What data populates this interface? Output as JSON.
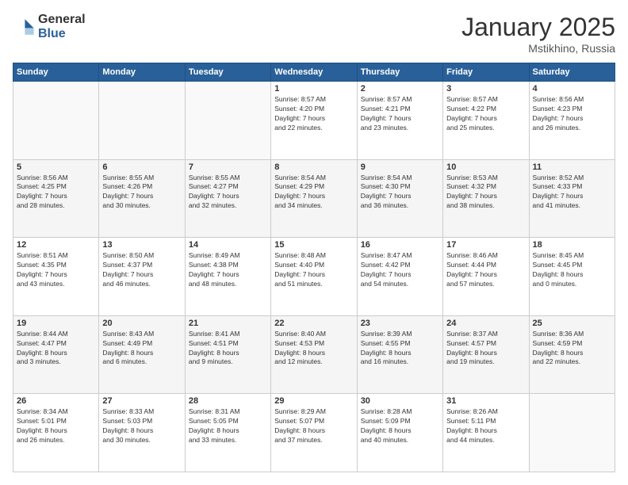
{
  "logo": {
    "general": "General",
    "blue": "Blue"
  },
  "title": "January 2025",
  "location": "Mstikhino, Russia",
  "days_header": [
    "Sunday",
    "Monday",
    "Tuesday",
    "Wednesday",
    "Thursday",
    "Friday",
    "Saturday"
  ],
  "weeks": [
    [
      {
        "day": "",
        "info": ""
      },
      {
        "day": "",
        "info": ""
      },
      {
        "day": "",
        "info": ""
      },
      {
        "day": "1",
        "info": "Sunrise: 8:57 AM\nSunset: 4:20 PM\nDaylight: 7 hours\nand 22 minutes."
      },
      {
        "day": "2",
        "info": "Sunrise: 8:57 AM\nSunset: 4:21 PM\nDaylight: 7 hours\nand 23 minutes."
      },
      {
        "day": "3",
        "info": "Sunrise: 8:57 AM\nSunset: 4:22 PM\nDaylight: 7 hours\nand 25 minutes."
      },
      {
        "day": "4",
        "info": "Sunrise: 8:56 AM\nSunset: 4:23 PM\nDaylight: 7 hours\nand 26 minutes."
      }
    ],
    [
      {
        "day": "5",
        "info": "Sunrise: 8:56 AM\nSunset: 4:25 PM\nDaylight: 7 hours\nand 28 minutes."
      },
      {
        "day": "6",
        "info": "Sunrise: 8:55 AM\nSunset: 4:26 PM\nDaylight: 7 hours\nand 30 minutes."
      },
      {
        "day": "7",
        "info": "Sunrise: 8:55 AM\nSunset: 4:27 PM\nDaylight: 7 hours\nand 32 minutes."
      },
      {
        "day": "8",
        "info": "Sunrise: 8:54 AM\nSunset: 4:29 PM\nDaylight: 7 hours\nand 34 minutes."
      },
      {
        "day": "9",
        "info": "Sunrise: 8:54 AM\nSunset: 4:30 PM\nDaylight: 7 hours\nand 36 minutes."
      },
      {
        "day": "10",
        "info": "Sunrise: 8:53 AM\nSunset: 4:32 PM\nDaylight: 7 hours\nand 38 minutes."
      },
      {
        "day": "11",
        "info": "Sunrise: 8:52 AM\nSunset: 4:33 PM\nDaylight: 7 hours\nand 41 minutes."
      }
    ],
    [
      {
        "day": "12",
        "info": "Sunrise: 8:51 AM\nSunset: 4:35 PM\nDaylight: 7 hours\nand 43 minutes."
      },
      {
        "day": "13",
        "info": "Sunrise: 8:50 AM\nSunset: 4:37 PM\nDaylight: 7 hours\nand 46 minutes."
      },
      {
        "day": "14",
        "info": "Sunrise: 8:49 AM\nSunset: 4:38 PM\nDaylight: 7 hours\nand 48 minutes."
      },
      {
        "day": "15",
        "info": "Sunrise: 8:48 AM\nSunset: 4:40 PM\nDaylight: 7 hours\nand 51 minutes."
      },
      {
        "day": "16",
        "info": "Sunrise: 8:47 AM\nSunset: 4:42 PM\nDaylight: 7 hours\nand 54 minutes."
      },
      {
        "day": "17",
        "info": "Sunrise: 8:46 AM\nSunset: 4:44 PM\nDaylight: 7 hours\nand 57 minutes."
      },
      {
        "day": "18",
        "info": "Sunrise: 8:45 AM\nSunset: 4:45 PM\nDaylight: 8 hours\nand 0 minutes."
      }
    ],
    [
      {
        "day": "19",
        "info": "Sunrise: 8:44 AM\nSunset: 4:47 PM\nDaylight: 8 hours\nand 3 minutes."
      },
      {
        "day": "20",
        "info": "Sunrise: 8:43 AM\nSunset: 4:49 PM\nDaylight: 8 hours\nand 6 minutes."
      },
      {
        "day": "21",
        "info": "Sunrise: 8:41 AM\nSunset: 4:51 PM\nDaylight: 8 hours\nand 9 minutes."
      },
      {
        "day": "22",
        "info": "Sunrise: 8:40 AM\nSunset: 4:53 PM\nDaylight: 8 hours\nand 12 minutes."
      },
      {
        "day": "23",
        "info": "Sunrise: 8:39 AM\nSunset: 4:55 PM\nDaylight: 8 hours\nand 16 minutes."
      },
      {
        "day": "24",
        "info": "Sunrise: 8:37 AM\nSunset: 4:57 PM\nDaylight: 8 hours\nand 19 minutes."
      },
      {
        "day": "25",
        "info": "Sunrise: 8:36 AM\nSunset: 4:59 PM\nDaylight: 8 hours\nand 22 minutes."
      }
    ],
    [
      {
        "day": "26",
        "info": "Sunrise: 8:34 AM\nSunset: 5:01 PM\nDaylight: 8 hours\nand 26 minutes."
      },
      {
        "day": "27",
        "info": "Sunrise: 8:33 AM\nSunset: 5:03 PM\nDaylight: 8 hours\nand 30 minutes."
      },
      {
        "day": "28",
        "info": "Sunrise: 8:31 AM\nSunset: 5:05 PM\nDaylight: 8 hours\nand 33 minutes."
      },
      {
        "day": "29",
        "info": "Sunrise: 8:29 AM\nSunset: 5:07 PM\nDaylight: 8 hours\nand 37 minutes."
      },
      {
        "day": "30",
        "info": "Sunrise: 8:28 AM\nSunset: 5:09 PM\nDaylight: 8 hours\nand 40 minutes."
      },
      {
        "day": "31",
        "info": "Sunrise: 8:26 AM\nSunset: 5:11 PM\nDaylight: 8 hours\nand 44 minutes."
      },
      {
        "day": "",
        "info": ""
      }
    ]
  ]
}
